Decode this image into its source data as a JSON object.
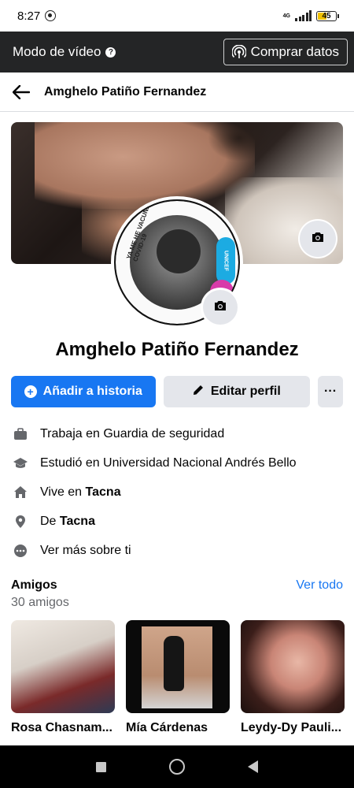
{
  "status_bar": {
    "time": "8:27",
    "network": "4G",
    "battery": "45",
    "icons": [
      "whatsapp-icon",
      "signal-icon",
      "battery-icon"
    ]
  },
  "video_bar": {
    "mode_label": "Modo de vídeo",
    "help_icon": "question-icon",
    "buy_label": "Comprar datos",
    "buy_icon": "wifi-broadcast-icon"
  },
  "header": {
    "back_icon": "arrow-left-icon",
    "title": "Amghelo Patiño Fernandez"
  },
  "profile": {
    "cover_camera_icon": "camera-icon",
    "avatar_ring_text": "YA ME HE VACUNADO CONTRA EL COVID-19",
    "avatar_badge_text": "UNICEF",
    "avatar_camera_icon": "camera-icon",
    "name": "Amghelo Patiño Fernandez"
  },
  "actions": {
    "add_story_label": "Añadir a historia",
    "edit_profile_label": "Editar perfil",
    "more_label": "···"
  },
  "details": [
    {
      "icon": "briefcase-icon",
      "prefix": "Trabaja en Guardia de seguridad",
      "bold": ""
    },
    {
      "icon": "graduation-cap-icon",
      "prefix": "Estudió en Universidad Nacional Andrés Bello",
      "bold": ""
    },
    {
      "icon": "home-icon",
      "prefix": "Vive en ",
      "bold": "Tacna"
    },
    {
      "icon": "location-pin-icon",
      "prefix": "De ",
      "bold": "Tacna"
    },
    {
      "icon": "more-dots-icon",
      "prefix": "Ver más sobre ti",
      "bold": ""
    }
  ],
  "friends": {
    "title": "Amigos",
    "count": "30 amigos",
    "see_all": "Ver todo",
    "items": [
      {
        "name": "Rosa Chasnam..."
      },
      {
        "name": "Mía Cárdenas"
      },
      {
        "name": "Leydy-Dy Pauli..."
      }
    ]
  },
  "colors": {
    "accent": "#1877f2",
    "dark_bar": "#242526",
    "secondary_button": "#e4e6eb",
    "muted_text": "#65676b"
  }
}
